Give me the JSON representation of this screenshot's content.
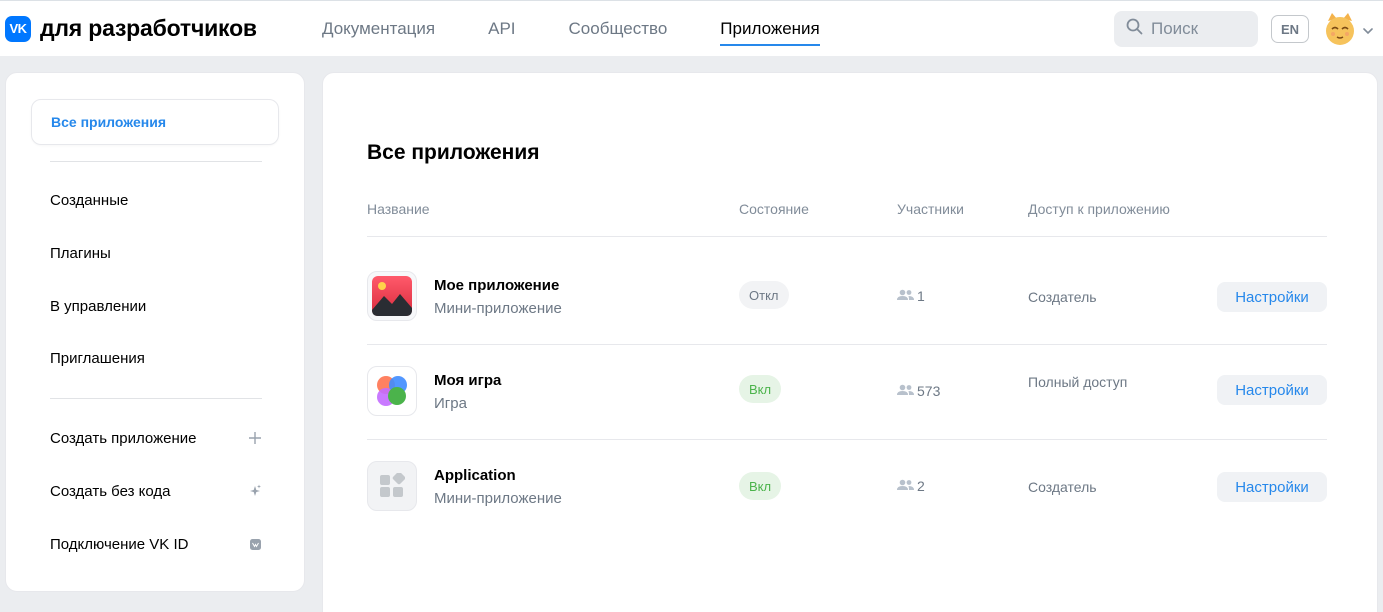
{
  "header": {
    "logo_badge": "VK",
    "logo_text": "для разработчиков",
    "nav": [
      {
        "label": "Документация"
      },
      {
        "label": "API"
      },
      {
        "label": "Сообщество"
      },
      {
        "label": "Приложения"
      }
    ],
    "active_nav": "Приложения",
    "search_placeholder": "Поиск",
    "lang": "EN"
  },
  "sidebar": {
    "active": "Все приложения",
    "items": [
      "Созданные",
      "Плагины",
      "В управлении",
      "Приглашения"
    ],
    "actions": [
      {
        "label": "Создать приложение",
        "icon": "plus-icon"
      },
      {
        "label": "Создать без кода",
        "icon": "sparkle-icon"
      },
      {
        "label": "Подключение VK ID",
        "icon": "vk-id-icon"
      }
    ]
  },
  "main": {
    "title": "Все приложения",
    "columns": [
      "Название",
      "Состояние",
      "Участники",
      "Доступ к приложению"
    ],
    "rows": [
      {
        "name": "Мое приложение",
        "type": "Мини-приложение",
        "status": "Откл",
        "members": "1",
        "access": "Создатель",
        "button": "Настройки",
        "icon": "picture-app-icon"
      },
      {
        "name": "Моя игра",
        "type": "Игра",
        "status": "Вкл",
        "members": "573",
        "access": "Полный доступ",
        "button": "Настройки",
        "icon": "circles-game-icon"
      },
      {
        "name": "Application",
        "type": "Мини-приложение",
        "status": "Вкл",
        "members": "2",
        "access": "Создатель",
        "button": "Настройки",
        "icon": "blocks-app-icon"
      }
    ]
  },
  "colors": {
    "accent": "#2688eb",
    "brand": "#0077ff",
    "status_on_text": "#4bb34b",
    "status_on_bg": "#e6f4e6",
    "status_off_bg": "#f2f3f5",
    "page_bg": "#ebedf0"
  }
}
